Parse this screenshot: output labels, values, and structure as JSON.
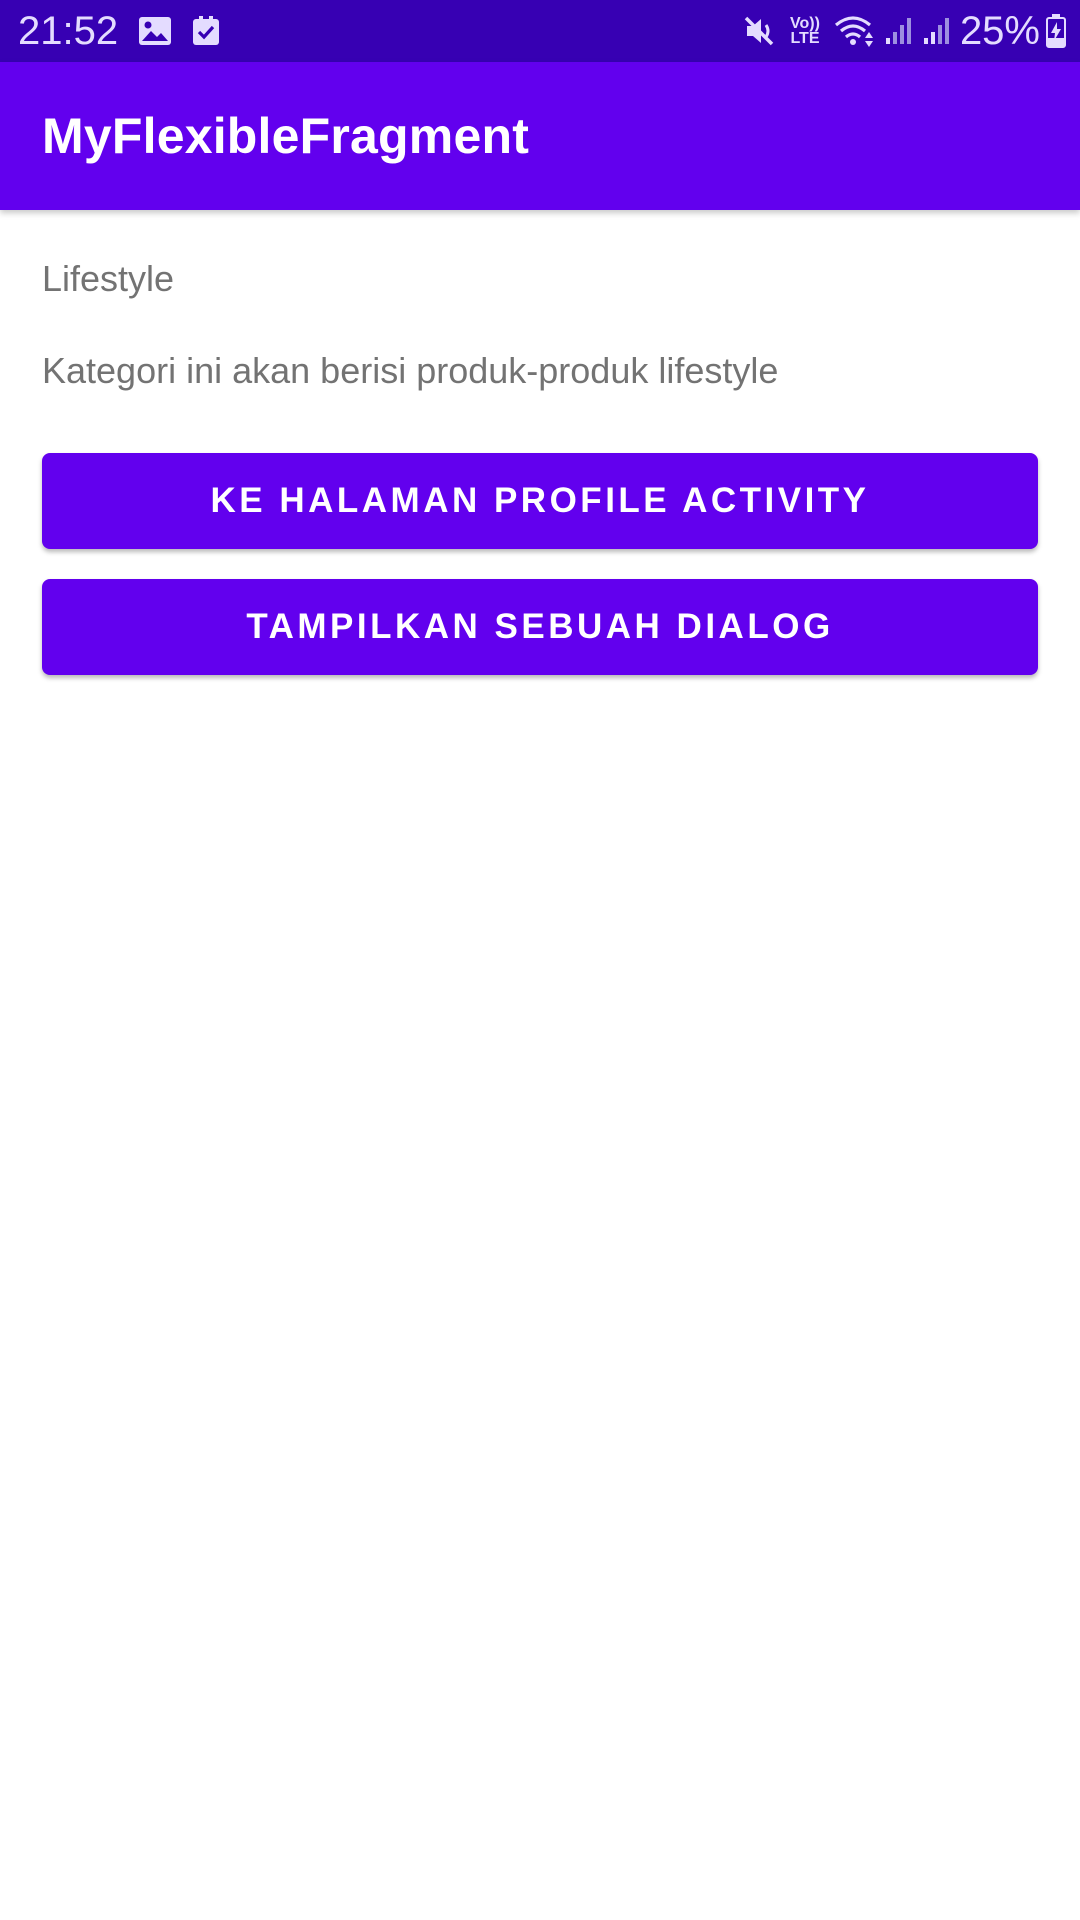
{
  "status_bar": {
    "time": "21:52",
    "left_icons": [
      "image-icon",
      "check-box-icon"
    ],
    "right_icons": [
      "mute-icon",
      "volte-icon",
      "wifi-icon",
      "signal-icon",
      "signal-icon-2",
      "battery-charging-icon"
    ],
    "volte_line1": "Vo))",
    "volte_line2": "LTE",
    "battery": "25%"
  },
  "app_bar": {
    "title": "MyFlexibleFragment"
  },
  "content": {
    "category_name": "Lifestyle",
    "category_description": "Kategori ini akan berisi produk-produk lifestyle",
    "buttons": [
      {
        "label": "KE HALAMAN PROFILE ACTIVITY"
      },
      {
        "label": "TAMPILKAN SEBUAH DIALOG"
      }
    ]
  },
  "colors": {
    "status_bar": "#3700b3",
    "primary": "#6200ee",
    "text_secondary": "#737373",
    "on_primary": "#ffffff"
  }
}
